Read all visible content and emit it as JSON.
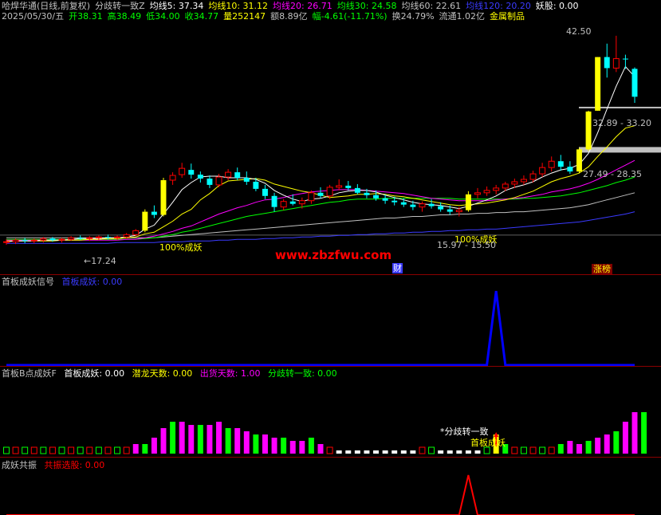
{
  "header": {
    "row1": [
      {
        "t": "哈焊华通(日线,前复权)",
        "c": "#c0c0c0"
      },
      {
        "t": "分歧转一致Z",
        "c": "#c0c0c0"
      },
      {
        "t": "均线5: 37.34",
        "c": "#ffffff"
      },
      {
        "t": "均线10: 31.12",
        "c": "#ffff00"
      },
      {
        "t": "均线20: 26.71",
        "c": "#ff00ff"
      },
      {
        "t": "均线30: 24.58",
        "c": "#00ff00"
      },
      {
        "t": "均线60: 22.61",
        "c": "#c0c0c0"
      },
      {
        "t": "均线120: 20.20",
        "c": "#3a3aff"
      },
      {
        "t": "妖股: 0.00",
        "c": "#ffffff"
      }
    ],
    "row2": [
      {
        "t": "2025/05/30/五",
        "c": "#c0c0c0"
      },
      {
        "t": "开38.31",
        "c": "#00ff00"
      },
      {
        "t": "高38.49",
        "c": "#00ff00"
      },
      {
        "t": "低34.00",
        "c": "#00ff00"
      },
      {
        "t": "收34.77",
        "c": "#00ff00"
      },
      {
        "t": "量252147",
        "c": "#ffff00"
      },
      {
        "t": "额8.89亿",
        "c": "#c0c0c0"
      },
      {
        "t": "幅-4.61(-11.71%)",
        "c": "#00ff00"
      },
      {
        "t": "换24.79%",
        "c": "#c0c0c0"
      },
      {
        "t": "流通1.02亿",
        "c": "#c0c0c0"
      },
      {
        "t": "金属制品",
        "c": "#ffff00"
      }
    ]
  },
  "annotations": {
    "high": "42.50",
    "r1": "32.89 - 33.20",
    "r2": "27.49 - 28.35",
    "low": "17.24",
    "cheng1": "100%成妖",
    "cheng2": "100%成妖",
    "lowbox": "15.97 - 15.50",
    "watermark": "www.zbzfwu.com",
    "cai": "财",
    "zhangbang": "涨榜"
  },
  "panel2": {
    "title": "首板成妖信号",
    "v1": "首板成妖: 0.00"
  },
  "panel3": {
    "title": "首板B点成妖F",
    "v1": "首板成妖: 0.00",
    "v2": "潜龙天数: 0.00",
    "v3": "出货天数: 1.00",
    "v4": "分歧转一致: 0.00",
    "ann1": "*分歧转一致",
    "ann2": "首板成妖"
  },
  "panel4": {
    "title": "成妖共振",
    "v1": "共振选股: 0.00"
  },
  "colors": {
    "up": "#ff0000",
    "down": "#00ffff",
    "yellow": "#ffff00",
    "grid": "#8b0000"
  },
  "chart_data": {
    "type": "candlestick",
    "ohlc": [
      [
        16.3,
        16.7,
        16.0,
        16.4
      ],
      [
        16.4,
        16.8,
        16.1,
        16.6
      ],
      [
        16.6,
        16.9,
        16.2,
        16.5
      ],
      [
        16.5,
        16.8,
        16.2,
        16.6
      ],
      [
        16.6,
        17.0,
        16.3,
        16.8
      ],
      [
        16.8,
        17.0,
        16.4,
        16.6
      ],
      [
        16.6,
        16.9,
        16.3,
        16.7
      ],
      [
        16.7,
        17.1,
        16.5,
        16.9
      ],
      [
        16.9,
        17.2,
        16.6,
        16.8
      ],
      [
        16.8,
        17.1,
        16.5,
        16.9
      ],
      [
        16.9,
        17.2,
        16.6,
        17.0
      ],
      [
        17.0,
        17.3,
        16.7,
        16.9
      ],
      [
        16.9,
        17.2,
        16.6,
        17.0
      ],
      [
        17.0,
        17.5,
        16.8,
        17.3
      ],
      [
        17.3,
        18.0,
        17.1,
        17.8
      ],
      [
        17.8,
        20.5,
        17.6,
        20.2
      ],
      [
        20.2,
        21.0,
        19.4,
        19.8
      ],
      [
        19.8,
        24.5,
        19.6,
        24.2
      ],
      [
        24.2,
        25.2,
        23.6,
        24.8
      ],
      [
        24.9,
        26.4,
        24.5,
        25.7
      ],
      [
        25.5,
        26.3,
        24.4,
        24.9
      ],
      [
        24.9,
        25.3,
        23.9,
        24.4
      ],
      [
        24.4,
        24.8,
        23.2,
        23.6
      ],
      [
        23.6,
        25.0,
        23.3,
        24.6
      ],
      [
        24.6,
        25.6,
        24.2,
        25.2
      ],
      [
        25.2,
        25.8,
        24.2,
        24.5
      ],
      [
        24.5,
        25.3,
        23.6,
        24.0
      ],
      [
        24.0,
        24.5,
        22.8,
        23.1
      ],
      [
        23.1,
        23.6,
        21.8,
        22.2
      ],
      [
        22.2,
        22.6,
        20.2,
        20.8
      ],
      [
        20.8,
        21.8,
        20.4,
        21.5
      ],
      [
        21.5,
        22.4,
        21.0,
        21.2
      ],
      [
        21.2,
        22.0,
        20.6,
        21.6
      ],
      [
        21.6,
        22.9,
        21.2,
        22.6
      ],
      [
        22.6,
        23.3,
        21.9,
        22.2
      ],
      [
        22.2,
        23.6,
        21.8,
        23.3
      ],
      [
        23.3,
        24.3,
        22.9,
        23.5
      ],
      [
        23.5,
        24.1,
        22.9,
        23.2
      ],
      [
        23.2,
        23.7,
        22.4,
        22.6
      ],
      [
        22.6,
        23.1,
        21.9,
        22.3
      ],
      [
        22.3,
        22.9,
        21.6,
        21.9
      ],
      [
        21.9,
        22.4,
        21.2,
        21.6
      ],
      [
        21.6,
        22.1,
        21.0,
        21.4
      ],
      [
        21.4,
        21.9,
        20.8,
        21.1
      ],
      [
        21.1,
        21.6,
        20.4,
        20.8
      ],
      [
        20.8,
        21.5,
        20.2,
        21.2
      ],
      [
        21.2,
        21.8,
        20.6,
        20.9
      ],
      [
        20.9,
        21.4,
        20.2,
        20.5
      ],
      [
        20.5,
        21.0,
        19.8,
        20.2
      ],
      [
        20.2,
        20.8,
        19.6,
        20.4
      ],
      [
        20.4,
        22.8,
        20.2,
        22.4
      ],
      [
        22.4,
        23.2,
        21.9,
        22.6
      ],
      [
        22.6,
        23.4,
        22.2,
        22.9
      ],
      [
        22.9,
        23.6,
        22.4,
        23.2
      ],
      [
        23.2,
        24.0,
        22.8,
        23.7
      ],
      [
        23.7,
        24.4,
        23.2,
        24.0
      ],
      [
        24.0,
        24.8,
        23.6,
        24.3
      ],
      [
        24.3,
        25.4,
        23.9,
        25.0
      ],
      [
        25.0,
        26.4,
        24.6,
        25.8
      ],
      [
        25.8,
        27.2,
        25.3,
        26.6
      ],
      [
        26.6,
        27.4,
        25.4,
        25.9
      ],
      [
        25.9,
        26.6,
        25.0,
        25.3
      ],
      [
        25.3,
        28.3,
        25.1,
        28.1
      ],
      [
        28.1,
        33.0,
        27.9,
        32.9
      ],
      [
        33.0,
        39.8,
        33.0,
        39.8
      ],
      [
        39.8,
        41.5,
        37.2,
        38.4
      ],
      [
        38.4,
        42.5,
        37.9,
        39.6
      ],
      [
        39.6,
        40.1,
        38.3,
        39.5
      ],
      [
        38.31,
        38.49,
        34.0,
        34.77
      ]
    ],
    "ma5": [
      16.4,
      16.5,
      16.5,
      16.5,
      16.6,
      16.6,
      16.6,
      16.7,
      16.8,
      16.8,
      16.8,
      16.9,
      16.9,
      17.0,
      17.2,
      18.0,
      18.5,
      19.9,
      21.4,
      23.0,
      23.9,
      24.6,
      24.7,
      24.7,
      24.5,
      24.5,
      24.5,
      24.3,
      23.8,
      22.9,
      22.3,
      21.8,
      21.5,
      21.8,
      21.9,
      22.2,
      22.6,
      22.8,
      22.9,
      22.9,
      22.7,
      22.3,
      22.0,
      21.7,
      21.4,
      21.2,
      21.1,
      21.0,
      20.8,
      20.6,
      20.9,
      21.3,
      21.7,
      22.2,
      22.9,
      23.3,
      23.6,
      24.0,
      24.6,
      25.1,
      25.5,
      25.7,
      26.2,
      27.6,
      30.2,
      33.2,
      36.1,
      38.6,
      37.3
    ],
    "ma10": [
      16.5,
      16.5,
      16.5,
      16.5,
      16.5,
      16.5,
      16.6,
      16.6,
      16.6,
      16.7,
      16.7,
      16.8,
      16.8,
      16.9,
      17.0,
      17.4,
      17.6,
      18.3,
      19.0,
      19.9,
      20.5,
      21.7,
      22.5,
      23.5,
      24.1,
      24.2,
      24.3,
      24.4,
      24.2,
      23.7,
      23.4,
      23.1,
      22.8,
      22.6,
      22.3,
      22.0,
      22.1,
      22.2,
      22.4,
      22.4,
      22.5,
      22.4,
      22.2,
      22.1,
      21.9,
      21.7,
      21.5,
      21.3,
      21.1,
      21.0,
      21.1,
      21.2,
      21.3,
      21.5,
      21.7,
      22.0,
      22.4,
      22.8,
      23.4,
      24.0,
      24.4,
      24.7,
      25.1,
      25.9,
      27.2,
      28.4,
      29.7,
      30.8,
      31.1
    ],
    "ma20": [
      16.6,
      16.6,
      16.6,
      16.6,
      16.6,
      16.6,
      16.6,
      16.6,
      16.6,
      16.6,
      16.6,
      16.6,
      16.6,
      16.7,
      16.7,
      16.9,
      17.1,
      17.4,
      17.7,
      18.1,
      18.4,
      18.9,
      19.4,
      19.9,
      20.3,
      20.7,
      21.0,
      21.4,
      21.7,
      21.8,
      22.0,
      22.3,
      22.5,
      22.7,
      22.8,
      22.9,
      23.0,
      23.0,
      23.0,
      22.9,
      22.8,
      22.7,
      22.6,
      22.5,
      22.3,
      22.1,
      21.9,
      21.8,
      21.7,
      21.6,
      21.6,
      21.6,
      21.6,
      21.7,
      21.8,
      21.9,
      22.0,
      22.2,
      22.4,
      22.7,
      22.9,
      23.1,
      23.4,
      23.8,
      24.3,
      24.9,
      25.5,
      26.1,
      26.7
    ],
    "ma30": [
      16.7,
      16.7,
      16.7,
      16.7,
      16.7,
      16.7,
      16.7,
      16.7,
      16.7,
      16.7,
      16.7,
      16.7,
      16.7,
      16.7,
      16.7,
      16.8,
      16.9,
      17.1,
      17.3,
      17.6,
      17.8,
      18.1,
      18.4,
      18.7,
      19.0,
      19.3,
      19.6,
      19.8,
      20.0,
      20.2,
      20.4,
      20.6,
      20.8,
      21.0,
      21.2,
      21.4,
      21.5,
      21.7,
      21.8,
      21.8,
      21.8,
      21.9,
      21.9,
      21.9,
      21.9,
      21.9,
      21.9,
      21.9,
      21.9,
      21.8,
      21.8,
      21.8,
      21.8,
      21.8,
      21.8,
      21.8,
      21.9,
      21.9,
      22.0,
      22.1,
      22.2,
      22.4,
      22.6,
      22.9,
      23.2,
      23.5,
      23.9,
      24.2,
      24.6
    ],
    "ma60": [
      16.9,
      16.9,
      16.9,
      16.9,
      16.9,
      16.9,
      16.9,
      16.9,
      16.9,
      16.9,
      16.9,
      16.9,
      16.9,
      16.9,
      16.9,
      16.9,
      16.9,
      17.0,
      17.1,
      17.2,
      17.3,
      17.4,
      17.5,
      17.6,
      17.7,
      17.8,
      17.9,
      18.0,
      18.1,
      18.2,
      18.3,
      18.4,
      18.5,
      18.6,
      18.7,
      18.8,
      18.9,
      19.0,
      19.1,
      19.2,
      19.3,
      19.4,
      19.4,
      19.5,
      19.6,
      19.6,
      19.7,
      19.8,
      19.8,
      19.9,
      19.9,
      20.0,
      20.0,
      20.1,
      20.1,
      20.2,
      20.2,
      20.3,
      20.4,
      20.5,
      20.6,
      20.7,
      20.9,
      21.1,
      21.4,
      21.7,
      22.0,
      22.3,
      22.6
    ],
    "ma120": [
      16.2,
      16.2,
      16.2,
      16.2,
      16.2,
      16.2,
      16.2,
      16.2,
      16.2,
      16.2,
      16.2,
      16.2,
      16.3,
      16.3,
      16.3,
      16.3,
      16.3,
      16.4,
      16.4,
      16.4,
      16.5,
      16.5,
      16.5,
      16.6,
      16.6,
      16.7,
      16.7,
      16.7,
      16.8,
      16.8,
      16.9,
      16.9,
      17.0,
      17.0,
      17.1,
      17.1,
      17.2,
      17.2,
      17.3,
      17.3,
      17.4,
      17.4,
      17.5,
      17.5,
      17.6,
      17.6,
      17.7,
      17.7,
      17.8,
      17.8,
      17.9,
      17.9,
      18.0,
      18.0,
      18.1,
      18.2,
      18.3,
      18.4,
      18.5,
      18.6,
      18.7,
      18.8,
      18.9,
      19.1,
      19.3,
      19.5,
      19.7,
      19.9,
      20.2
    ],
    "signal1": [
      0,
      0,
      0,
      0,
      0,
      0,
      0,
      0,
      0,
      0,
      0,
      0,
      0,
      0,
      0,
      0,
      0,
      0,
      0,
      0,
      0,
      0,
      0,
      0,
      0,
      0,
      0,
      0,
      0,
      0,
      0,
      0,
      0,
      0,
      0,
      0,
      0,
      0,
      0,
      0,
      0,
      0,
      0,
      0,
      0,
      0,
      0,
      0,
      0,
      0,
      0,
      0,
      0,
      1,
      0,
      0,
      0,
      0,
      0,
      0,
      0,
      0,
      0,
      0,
      0,
      0,
      0,
      0,
      0
    ],
    "hist": [
      2,
      2,
      2,
      2,
      2,
      2,
      2,
      2,
      2,
      2,
      2,
      2,
      2,
      2,
      3,
      3,
      5,
      8,
      10,
      10,
      9,
      9,
      9,
      10,
      8,
      8,
      7,
      6,
      6,
      5,
      5,
      4,
      4,
      5,
      3,
      2,
      1,
      1,
      1,
      1,
      1,
      1,
      1,
      1,
      1,
      2,
      2,
      1,
      1,
      1,
      1,
      1,
      2,
      6,
      3,
      2,
      2,
      2,
      2,
      2,
      3,
      4,
      3,
      4,
      5,
      6,
      7,
      10,
      13,
      13
    ],
    "signal3": [
      0,
      0,
      0,
      0,
      0,
      0,
      0,
      0,
      0,
      0,
      0,
      0,
      0,
      0,
      0,
      0,
      0,
      0,
      0,
      0,
      0,
      0,
      0,
      0,
      0,
      0,
      0,
      0,
      0,
      0,
      0,
      0,
      0,
      0,
      0,
      0,
      0,
      0,
      0,
      0,
      0,
      0,
      0,
      0,
      0,
      0,
      0,
      0,
      0,
      0,
      1,
      0,
      0,
      0,
      0,
      0,
      0,
      0,
      0,
      0,
      0,
      0,
      0,
      0,
      0,
      0,
      0,
      0,
      0
    ]
  }
}
